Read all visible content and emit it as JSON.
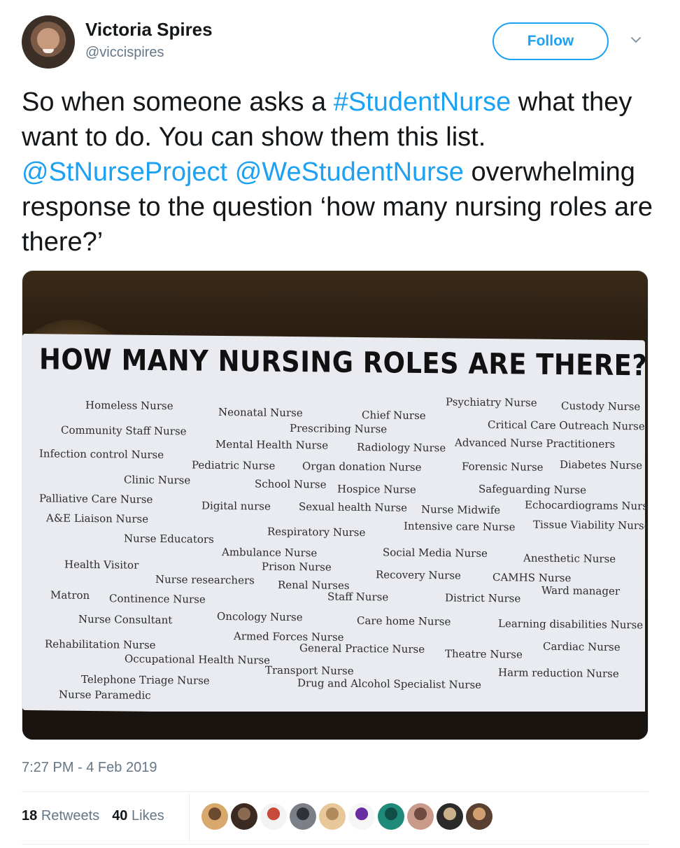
{
  "author": {
    "name": "Victoria Spires",
    "handle": "@viccispires"
  },
  "follow_label": "Follow",
  "tweet": {
    "parts": [
      "So when someone asks a ",
      "#StudentNurse",
      " what they want to do. You can show them this list. ",
      "@StNurseProject",
      " ",
      "@WeStudentNurse",
      " overwhelming response to the question ‘how many nursing roles are there?’"
    ]
  },
  "poster": {
    "title": "HOW MANY NURSING ROLES ARE THERE?",
    "roles": [
      "Homeless Nurse",
      "Neonatal Nurse",
      "Chief Nurse",
      "Psychiatry Nurse",
      "Custody Nurse",
      "Community Staff Nurse",
      "Prescribing Nurse",
      "Critical Care Outreach Nurse",
      "Mental Health Nurse",
      "Radiology Nurse",
      "Advanced Nurse Practitioners",
      "Infection control Nurse",
      "Pediatric Nurse",
      "Organ donation Nurse",
      "Forensic Nurse",
      "Diabetes Nurse",
      "Clinic Nurse",
      "School Nurse",
      "Hospice Nurse",
      "Safeguarding Nurse",
      "Palliative Care Nurse",
      "Digital nurse",
      "Sexual health Nurse",
      "Nurse Midwife",
      "Echocardiograms Nurse",
      "A&E Liaison Nurse",
      "Intensive care Nurse",
      "Tissue Viability Nurse",
      "Nurse Educators",
      "Respiratory Nurse",
      "Ambulance Nurse",
      "Social Media Nurse",
      "Anesthetic Nurse",
      "Health Visitor",
      "Prison Nurse",
      "Nurse researchers",
      "Recovery Nurse",
      "CAMHS Nurse",
      "Renal Nurses",
      "Ward manager",
      "Matron",
      "Continence Nurse",
      "Staff Nurse",
      "District Nurse",
      "Nurse Consultant",
      "Oncology Nurse",
      "Care home Nurse",
      "Learning disabilities Nurse",
      "Armed Forces Nurse",
      "Rehabilitation Nurse",
      "General Practice Nurse",
      "Cardiac Nurse",
      "Theatre Nurse",
      "Occupational Health Nurse",
      "Transport Nurse",
      "Harm reduction Nurse",
      "Telephone Triage Nurse",
      "Drug and Alcohol Specialist Nurse",
      "Nurse Paramedic"
    ]
  },
  "timestamp": "7:27 PM - 4 Feb 2019",
  "stats": {
    "retweets_count": "18",
    "retweets_label": "Retweets",
    "likes_count": "40",
    "likes_label": "Likes"
  },
  "likers_count": 10,
  "colors": {
    "link": "#1da1f2",
    "text": "#14171a",
    "secondary": "#657786"
  }
}
